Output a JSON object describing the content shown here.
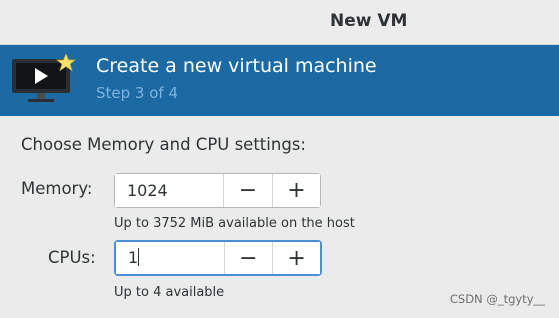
{
  "window": {
    "title": "New VM"
  },
  "banner": {
    "icon": "monitor-play-star-icon",
    "heading": "Create a new virtual machine",
    "step": "Step 3 of 4"
  },
  "section_title": "Choose Memory and CPU settings:",
  "memory": {
    "label": "Memory:",
    "value": "1024",
    "decrement": "−",
    "increment": "+",
    "hint": "Up to 3752 MiB available on the host"
  },
  "cpus": {
    "label": "CPUs:",
    "value": "1",
    "decrement": "−",
    "increment": "+",
    "hint": "Up to 4 available"
  },
  "watermark": "CSDN @_tgyty__",
  "colors": {
    "banner_bg": "#1b6aa3",
    "step_text": "#7fb3dc",
    "focus_ring": "#4a90d9"
  }
}
